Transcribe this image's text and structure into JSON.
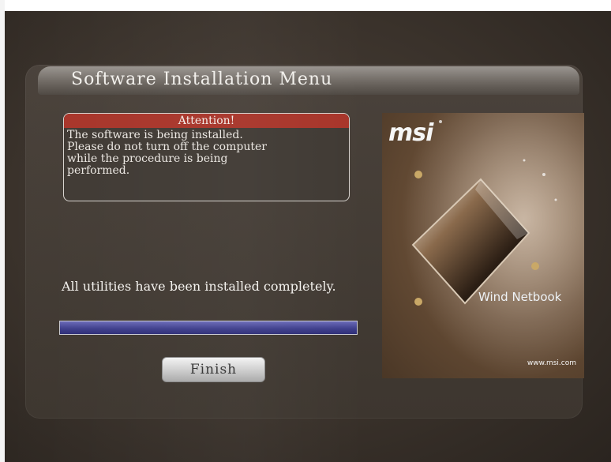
{
  "window": {
    "title": "Software Installation Menu"
  },
  "attention": {
    "heading": "Attention!",
    "message": "The software is being installed.\nPlease do not turn off the computer\nwhile the procedure is being\nperformed."
  },
  "status": {
    "text": "All utilities have been installed completely.",
    "progress": 1.0
  },
  "buttons": {
    "finish_label": "Finish"
  },
  "poster": {
    "logo": "msi",
    "tagline": "Wind Netbook",
    "url": "www.msi.com"
  },
  "colors": {
    "attention_header": "#a8352a",
    "progress_fill": "#3d3d8a",
    "panel_bg": "#403a34"
  }
}
